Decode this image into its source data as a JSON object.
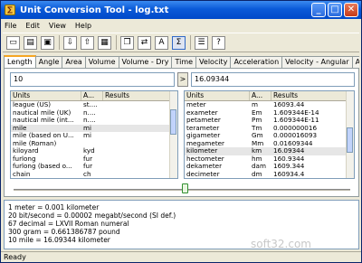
{
  "window": {
    "title": "Unit Conversion Tool - log.txt",
    "app_icon": "calculator-icon"
  },
  "title_buttons": {
    "minimize": "_",
    "maximize": "□",
    "close": "✕"
  },
  "menu": [
    "File",
    "Edit",
    "View",
    "Help"
  ],
  "toolbar": [
    "new-icon",
    "open-icon",
    "save-icon",
    "export-icon",
    "import-icon",
    "print-icon",
    "copy-icon",
    "convert-icon",
    "sort-icon",
    "sum-icon",
    "options-icon",
    "help-icon"
  ],
  "tabs": [
    {
      "label": "Length",
      "active": true
    },
    {
      "label": "Angle",
      "active": false
    },
    {
      "label": "Area",
      "active": false
    },
    {
      "label": "Volume",
      "active": false
    },
    {
      "label": "Volume - Dry",
      "active": false
    },
    {
      "label": "Time",
      "active": false
    },
    {
      "label": "Velocity",
      "active": false
    },
    {
      "label": "Acceleration",
      "active": false
    },
    {
      "label": "Velocity - Angular",
      "active": false
    },
    {
      "label": "Acce",
      "active": false
    }
  ],
  "input": {
    "value": "10",
    "arrow": ">"
  },
  "result": {
    "value": "16.09344"
  },
  "left_list": {
    "headers": [
      "Units",
      "A...",
      "Results"
    ],
    "rows": [
      {
        "unit": "league (US)",
        "abbr": "st....",
        "result": "",
        "selected": false
      },
      {
        "unit": "nautical mile (UK)",
        "abbr": "n....",
        "result": "",
        "selected": false
      },
      {
        "unit": "nautical mile (int...",
        "abbr": "n....",
        "result": "",
        "selected": false
      },
      {
        "unit": "mile",
        "abbr": "mi",
        "result": "",
        "selected": true
      },
      {
        "unit": "mile (based on U...",
        "abbr": "mi",
        "result": "",
        "selected": false
      },
      {
        "unit": "mile (Roman)",
        "abbr": "",
        "result": "",
        "selected": false
      },
      {
        "unit": "kiloyard",
        "abbr": "kyd",
        "result": "",
        "selected": false
      },
      {
        "unit": "furlong",
        "abbr": "fur",
        "result": "",
        "selected": false
      },
      {
        "unit": "furlong (based o...",
        "abbr": "fur",
        "result": "",
        "selected": false
      },
      {
        "unit": "chain",
        "abbr": "ch",
        "result": "",
        "selected": false
      }
    ]
  },
  "right_list": {
    "headers": [
      "Units",
      "A...",
      "Results"
    ],
    "rows": [
      {
        "unit": "meter",
        "abbr": "m",
        "result": "16093.44",
        "selected": false
      },
      {
        "unit": "exameter",
        "abbr": "Em",
        "result": "1.609344E-14",
        "selected": false
      },
      {
        "unit": "petameter",
        "abbr": "Pm",
        "result": "1.609344E-11",
        "selected": false
      },
      {
        "unit": "terameter",
        "abbr": "Tm",
        "result": "0.000000016",
        "selected": false
      },
      {
        "unit": "gigameter",
        "abbr": "Gm",
        "result": "0.000016093",
        "selected": false
      },
      {
        "unit": "megameter",
        "abbr": "Mm",
        "result": "0.01609344",
        "selected": false
      },
      {
        "unit": "kilometer",
        "abbr": "km",
        "result": "16.09344",
        "selected": true
      },
      {
        "unit": "hectometer",
        "abbr": "hm",
        "result": "160.9344",
        "selected": false
      },
      {
        "unit": "dekameter",
        "abbr": "dam",
        "result": "1609.344",
        "selected": false
      },
      {
        "unit": "decimeter",
        "abbr": "dm",
        "result": "160934.4",
        "selected": false
      }
    ]
  },
  "output_lines": [
    "1 meter = 0.001 kilometer",
    "20 bit/second = 0.00002 megabt/second (SI def.)",
    "67 decimal = LXVII Roman numeral",
    "300 gram = 0.661386787 pound",
    "10 mile = 16.09344 kilometer"
  ],
  "status": "Ready",
  "watermark": "soft32.com"
}
